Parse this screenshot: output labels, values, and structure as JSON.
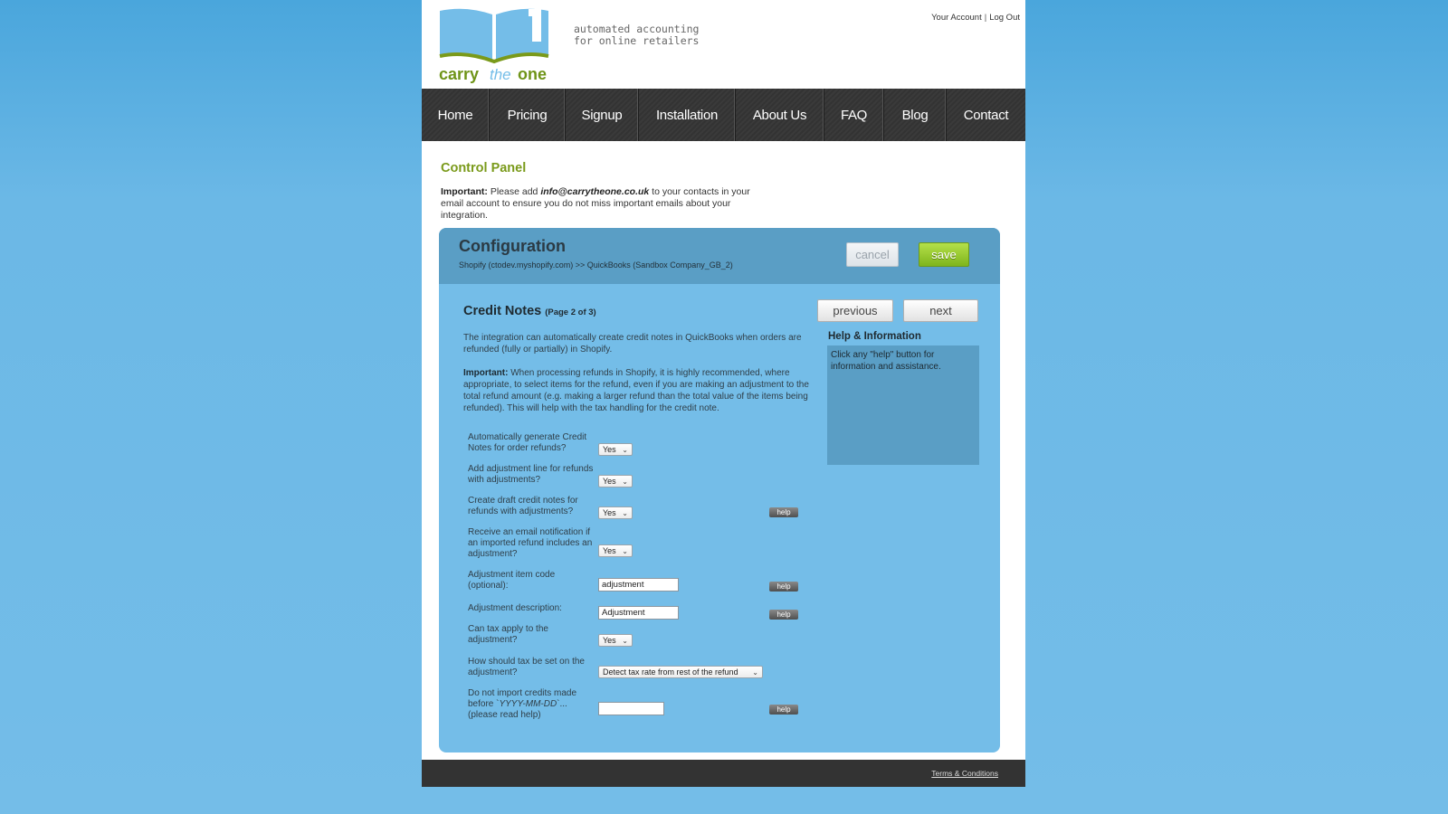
{
  "header": {
    "logo_text": {
      "carry": "carry",
      "the": "the",
      "one": "one"
    },
    "tagline_line1": "automated accounting",
    "tagline_line2": "for online retailers",
    "your_account": "Your Account",
    "separator": "|",
    "log_out": "Log Out"
  },
  "nav": {
    "items": [
      {
        "label": "Home"
      },
      {
        "label": "Pricing"
      },
      {
        "label": "Signup"
      },
      {
        "label": "Installation"
      },
      {
        "label": "About Us"
      },
      {
        "label": "FAQ"
      },
      {
        "label": "Blog"
      },
      {
        "label": "Contact"
      }
    ]
  },
  "control_panel": {
    "title": "Control Panel",
    "notice_prefix": "Important:",
    "notice_text_1": " Please add ",
    "notice_email": "info@carrytheone.co.uk",
    "notice_text_2": " to your contacts in your email account to ensure you do not miss important emails about your integration."
  },
  "config": {
    "title": "Configuration",
    "subtitle": "Shopify (ctodev.myshopify.com) >> QuickBooks (Sandbox Company_GB_2)",
    "cancel_label": "cancel",
    "save_label": "save",
    "previous_label": "previous",
    "next_label": "next",
    "section_title": "Credit Notes",
    "page_indicator": "(Page 2 of 3)",
    "intro": "The integration can automatically create credit notes in QuickBooks when orders are refunded (fully or partially) in Shopify.",
    "important_prefix": "Important:",
    "important_text": " When processing refunds in Shopify, it is highly recommended, where appropriate, to select items for the refund, even if you are making an adjustment to the total refund amount (e.g. making a larger refund than the total value of the items being refunded). This will help with the tax handling for the credit note.",
    "help_title": "Help & Information",
    "help_text": "Click any \"help\" button for information and assistance.",
    "help_label": "help"
  },
  "form": {
    "auto_generate": {
      "label": "Automatically generate Credit Notes for order refunds?",
      "value": "Yes"
    },
    "add_adjustment_line": {
      "label": "Add adjustment line for refunds with adjustments?",
      "value": "Yes"
    },
    "create_draft": {
      "label": "Create draft credit notes for refunds with adjustments?",
      "value": "Yes"
    },
    "email_notification": {
      "label": "Receive an email notification if an imported refund includes an adjustment?",
      "value": "Yes"
    },
    "adjustment_item_code": {
      "label": "Adjustment item code (optional):",
      "value": "adjustment"
    },
    "adjustment_description": {
      "label": "Adjustment description:",
      "value": "Adjustment"
    },
    "tax_apply": {
      "label": "Can tax apply to the adjustment?",
      "value": "Yes"
    },
    "tax_set": {
      "label": "How should tax be set on the adjustment?",
      "value": "Detect tax rate from rest of the refund"
    },
    "import_before": {
      "label_prefix": "Do not import credits made before `",
      "label_format": "YYYY-MM-DD",
      "label_suffix": "`... (please read help)",
      "value": ""
    }
  },
  "footer": {
    "terms": "Terms & Conditions"
  }
}
